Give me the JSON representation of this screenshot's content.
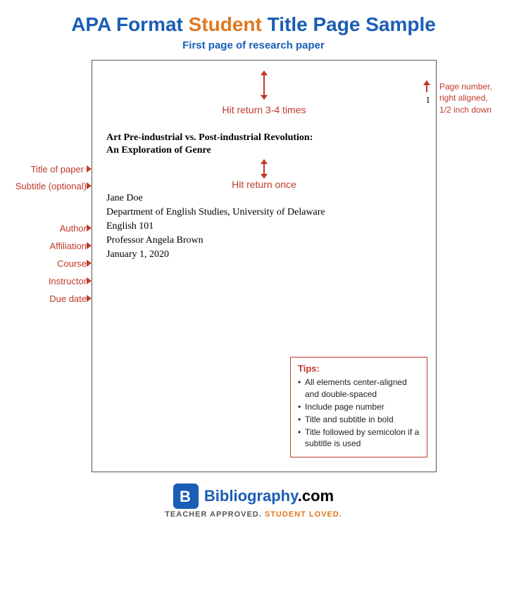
{
  "page": {
    "main_title_blue1": "APA Format ",
    "main_title_orange": "Student",
    "main_title_blue2": " Title Page Sample",
    "subtitle": "First page of research paper",
    "paper": {
      "page_number": "1",
      "hit_return_label": "Hit return 3-4 times",
      "title_label": "Title of paper",
      "title_value": "Art Pre-industrial vs. Post-industrial Revolution:",
      "subtitle_label": "Subtitle (optional)",
      "subtitle_value": "An Exploration of Genre",
      "hit_return_once": "Hit return once",
      "author_label": "Author",
      "author_value": "Jane Doe",
      "affiliation_label": "Affiliation",
      "affiliation_value": "Department of English Studies, University of Delaware",
      "course_label": "Course",
      "course_value": "English 101",
      "instructor_label": "Instructor",
      "instructor_value": "Professor Angela Brown",
      "due_date_label": "Due date",
      "due_date_value": "January 1, 2020"
    },
    "right_note": {
      "line1": "Page number,",
      "line2": "right aligned,",
      "line3": "1/2 inch down"
    },
    "tips": {
      "title": "Tips:",
      "items": [
        "All elements center-aligned and double-spaced",
        "Include page number",
        "Title and subtitle in bold",
        "Title followed by semicolon if a subtitle is used"
      ]
    }
  },
  "footer": {
    "site_name_blue": "Bibliography",
    "site_name_rest": ".com",
    "tagline_white": "TEACHER APPROVED. ",
    "tagline_orange": "STUDENT LOVED."
  }
}
